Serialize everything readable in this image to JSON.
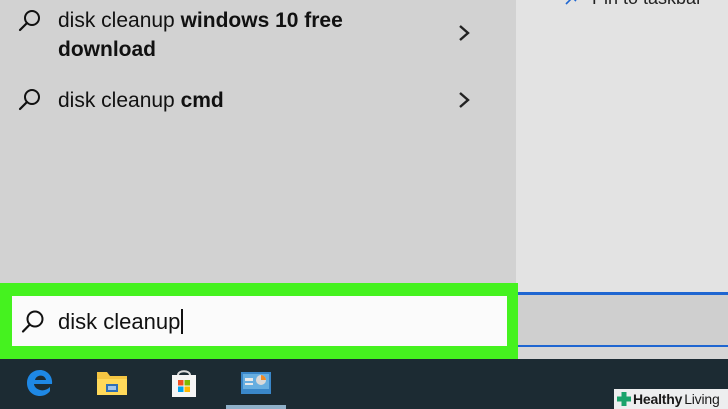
{
  "suggestions": [
    {
      "prefix": "disk cleanup ",
      "bold": "windows 10 free download",
      "icon": "search-icon",
      "chevron": "chevron-right-icon"
    },
    {
      "prefix": "disk cleanup ",
      "bold": "cmd",
      "icon": "search-icon",
      "chevron": "chevron-right-icon"
    }
  ],
  "right_panel": {
    "pin_label": "Pin to taskbar"
  },
  "search": {
    "value": "disk cleanup",
    "highlight_color": "#45f21f"
  },
  "taskbar": {
    "items": [
      "edge-icon",
      "file-explorer-icon",
      "microsoft-store-icon",
      "disk-cleanup-app-icon"
    ],
    "background": "#1c2b33"
  },
  "watermark": {
    "word1": "Healthy",
    "word2": "Living"
  },
  "colors": {
    "accent_blue": "#1f66d1",
    "green_highlight": "#45f21f"
  }
}
